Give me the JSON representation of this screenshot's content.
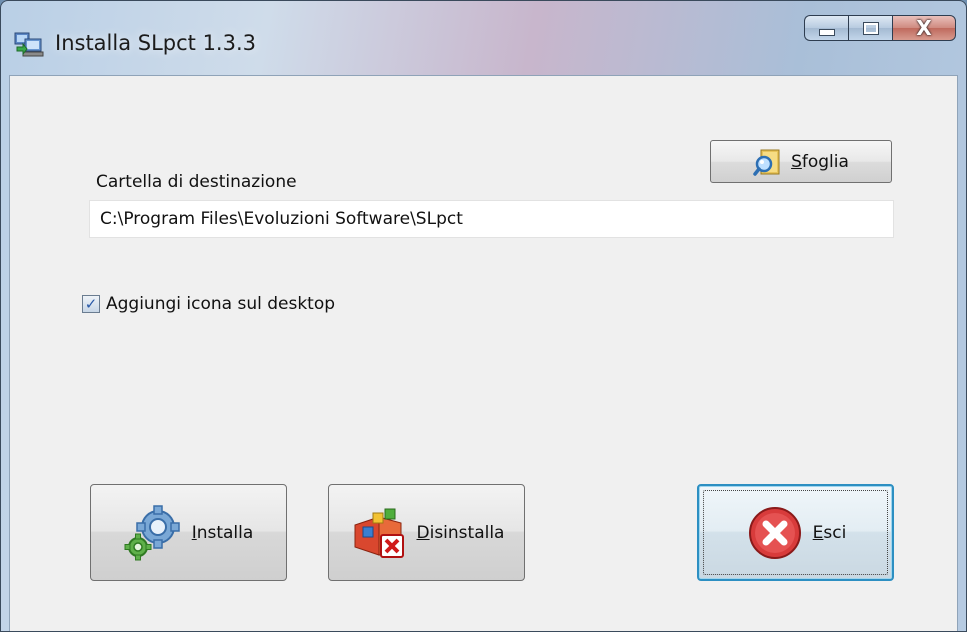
{
  "window": {
    "title": "Installa SLpct 1.3.3",
    "close_glyph": "X"
  },
  "form": {
    "destination_label": "Cartella di destinazione",
    "destination_value": "C:\\Program Files\\Evoluzioni Software\\SLpct",
    "browse_label_first": "S",
    "browse_label_rest": "foglia",
    "desktop_icon_label": "Aggiungi icona sul desktop",
    "desktop_icon_checked": true
  },
  "buttons": {
    "install_first": "I",
    "install_rest": "nstalla",
    "uninstall_first": "D",
    "uninstall_rest": "isinstalla",
    "exit_first": "E",
    "exit_rest": "sci"
  },
  "icons": {
    "app": "installer-computer-icon",
    "browse": "folder-search-icon",
    "install": "gears-icon",
    "uninstall": "remove-program-icon",
    "exit": "red-x-circle-icon"
  }
}
